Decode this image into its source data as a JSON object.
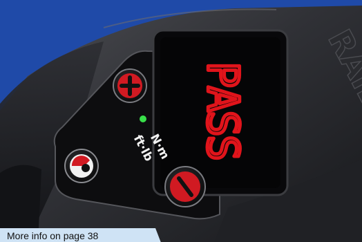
{
  "display": {
    "readout": "PASS",
    "digit_color": "#e0141b",
    "led_color": "#39e04a"
  },
  "units": {
    "primary": "N·m",
    "secondary": "ft·lb"
  },
  "buttons": {
    "increase_symbol": "+",
    "decrease_symbol": "−",
    "accent_color": "#d11a22"
  },
  "brand_fragment": "RAIL",
  "caption": {
    "text": "More info on page 38"
  }
}
